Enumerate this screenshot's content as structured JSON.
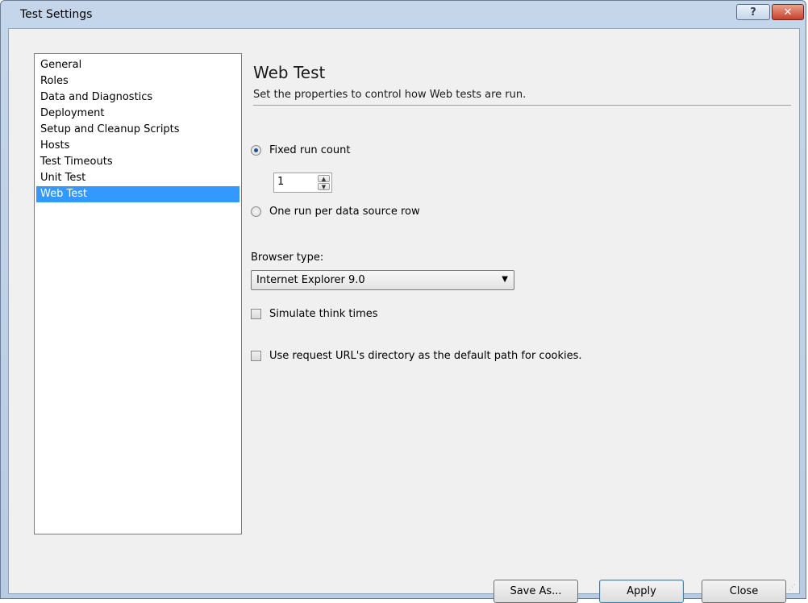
{
  "window": {
    "title": "Test Settings",
    "help_glyph": "?",
    "close_glyph": "✕"
  },
  "sidebar": {
    "items": [
      {
        "label": "General"
      },
      {
        "label": "Roles"
      },
      {
        "label": "Data and Diagnostics"
      },
      {
        "label": "Deployment"
      },
      {
        "label": "Setup and Cleanup Scripts"
      },
      {
        "label": "Hosts"
      },
      {
        "label": "Test Timeouts"
      },
      {
        "label": "Unit Test"
      },
      {
        "label": "Web Test"
      }
    ],
    "selected_index": 8
  },
  "panel": {
    "title": "Web Test",
    "description": "Set the properties to control how Web tests are run.",
    "fixed_run_label": "Fixed run count",
    "fixed_run_checked": true,
    "run_count_value": "1",
    "per_row_label": "One run per data source row",
    "per_row_checked": false,
    "browser_label": "Browser type:",
    "browser_value": "Internet Explorer 9.0",
    "think_times_label": "Simulate think times",
    "think_times_checked": false,
    "cookies_label": "Use request URL's directory as the default path for cookies.",
    "cookies_checked": false
  },
  "buttons": {
    "save_as": "Save As...",
    "apply": "Apply",
    "close": "Close"
  },
  "icons": {
    "up_arrow": "▲",
    "down_arrow": "▼",
    "dropdown_arrow": "▼"
  }
}
